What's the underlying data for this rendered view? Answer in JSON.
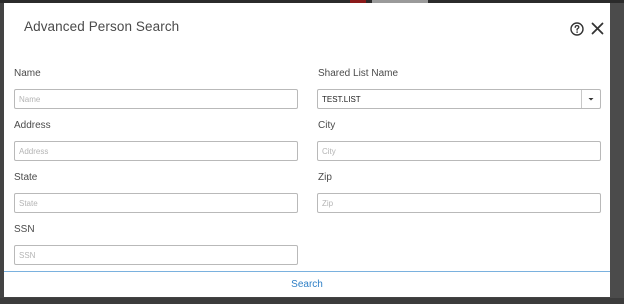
{
  "dialog": {
    "title": "Advanced Person Search"
  },
  "fields": {
    "name": {
      "label": "Name",
      "placeholder": "Name",
      "value": ""
    },
    "shared_list": {
      "label": "Shared List Name",
      "value": "TEST.LIST"
    },
    "address": {
      "label": "Address",
      "placeholder": "Address",
      "value": ""
    },
    "city": {
      "label": "City",
      "placeholder": "City",
      "value": ""
    },
    "state": {
      "label": "State",
      "placeholder": "State",
      "value": ""
    },
    "zip": {
      "label": "Zip",
      "placeholder": "Zip",
      "value": ""
    },
    "ssn": {
      "label": "SSN",
      "placeholder": "SSN",
      "value": ""
    }
  },
  "footer": {
    "search_label": "Search"
  },
  "icons": {
    "help": "help-circle-icon",
    "close": "close-icon",
    "dropdown": "caret-down-icon"
  },
  "colors": {
    "accent": "#2e7fc6",
    "footer_line": "#7ab1de",
    "overlay": "#434343"
  }
}
